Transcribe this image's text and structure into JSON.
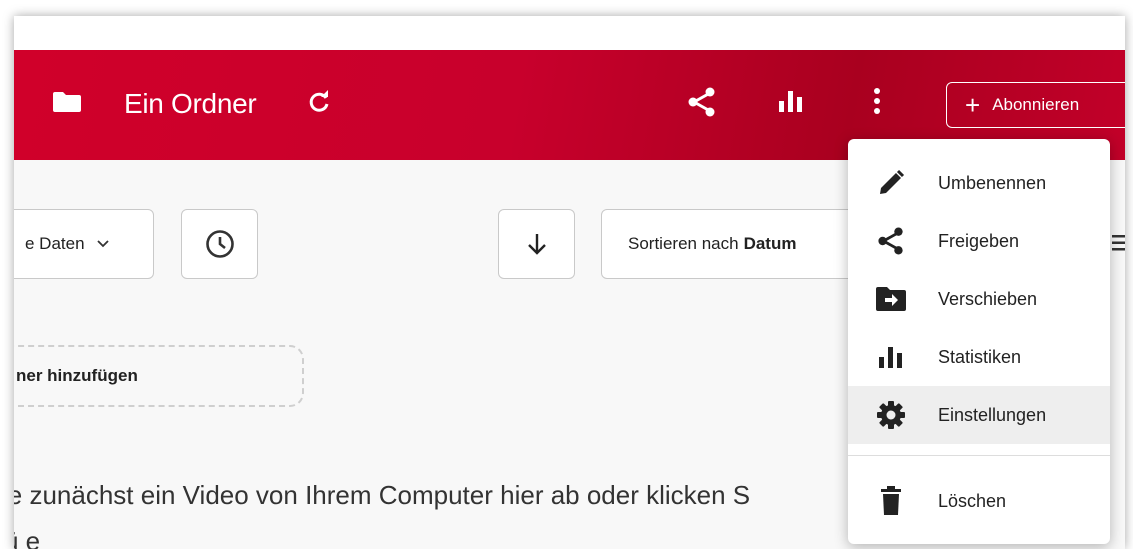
{
  "header": {
    "title": "Ein Ordner",
    "subscribe_plus": "+",
    "subscribe_label": "Abonnieren",
    "accent_color": "#c8002c"
  },
  "icons": {
    "folder": "folder-icon",
    "refresh": "refresh-icon",
    "share": "share-icon",
    "stats": "bar-chart-icon",
    "more": "kebab-menu-icon",
    "clock": "clock-icon",
    "sort_direction": "arrow-down-icon",
    "list_view": "list-view-icon"
  },
  "toolbar": {
    "data_filter_label": "e Daten",
    "data_filter_chevron": "⌄",
    "sort_prefix": "Sortieren nach",
    "sort_value": "Datum"
  },
  "main": {
    "add_container_label": "ner hinzufügen",
    "hint_line1": "ie zunächst ein Video von Ihrem Computer hier ab oder klicken S",
    "hint_line2": "ü                                        e"
  },
  "context_menu": {
    "items": [
      {
        "label": "Umbenennen",
        "icon": "pencil-icon"
      },
      {
        "label": "Freigeben",
        "icon": "share-icon"
      },
      {
        "label": "Verschieben",
        "icon": "move-folder-icon"
      },
      {
        "label": "Statistiken",
        "icon": "bar-chart-icon"
      },
      {
        "label": "Einstellungen",
        "icon": "gear-icon",
        "highlighted": true
      },
      {
        "label": "Löschen",
        "icon": "trash-icon"
      }
    ]
  }
}
